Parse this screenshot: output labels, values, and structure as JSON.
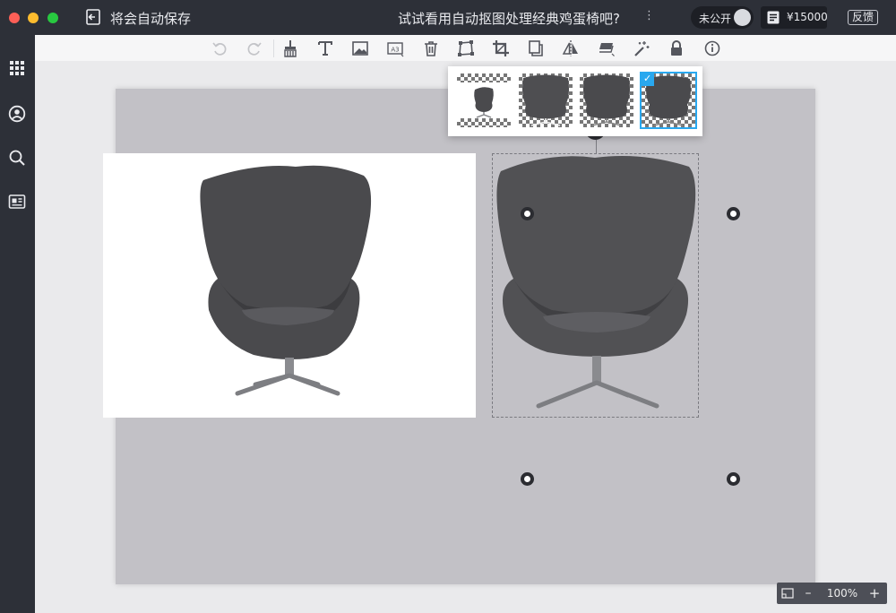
{
  "window": {
    "autosave_label": "将会自动保存",
    "title": "试试看用自动抠图处理经典鸡蛋椅吧?",
    "more_icon": "⋮",
    "privacy_toggle": {
      "label": "未公开",
      "state": "off"
    },
    "price": "¥15000",
    "feedback_label": "反馈"
  },
  "sidebar": {
    "items": [
      {
        "icon": "grid-icon"
      },
      {
        "icon": "user-circle-icon"
      },
      {
        "icon": "search-icon"
      },
      {
        "icon": "media-card-icon"
      }
    ]
  },
  "toolbar": {
    "items": [
      "undo-icon",
      "redo-icon",
      "brush-icon",
      "text-icon",
      "image-icon",
      "a3-paper-icon",
      "delete-icon",
      "transform-icon",
      "crop-icon",
      "duplicate-icon",
      "flip-icon",
      "layer-icon",
      "magic-wand-icon",
      "lock-icon",
      "info-icon"
    ],
    "a3_label": "A3"
  },
  "variants": {
    "selected_index": 3,
    "check_mark": "✓"
  },
  "zoom": {
    "minus": "–",
    "value": "100%",
    "plus": "+"
  },
  "colors": {
    "accent": "#29a8ef",
    "titlebar": "#2d3038",
    "canvas": "#c2c1c6"
  }
}
